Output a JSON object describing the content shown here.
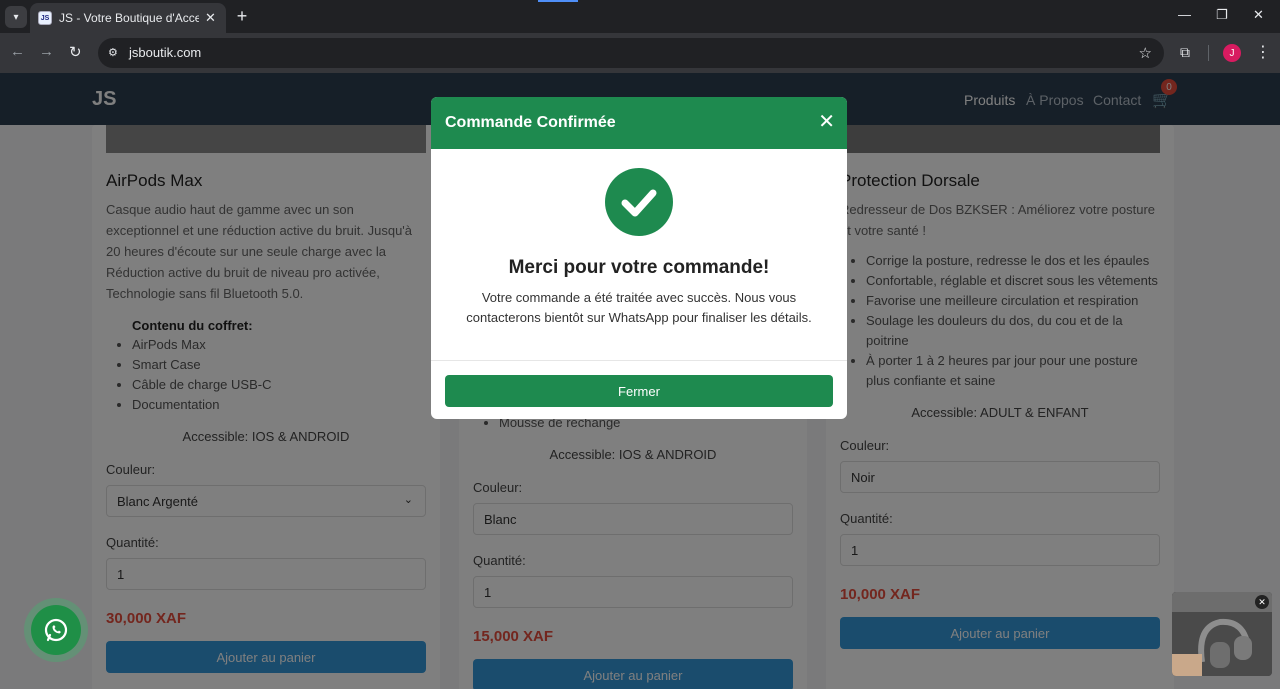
{
  "browser": {
    "tab_title": "JS - Votre Boutique d'Accessoires",
    "favicon_text": "JS",
    "url": "jsboutik.com",
    "profile_initial": "J"
  },
  "site": {
    "logo": "JS",
    "nav": [
      "Produits",
      "À Propos",
      "Contact"
    ],
    "cart_count": "0"
  },
  "products": [
    {
      "name": "AirPods Max",
      "description": "Casque audio haut de gamme avec un son exceptionnel et une réduction active du bruit. Jusqu'à 20 heures d'écoute sur une seule charge avec la Réduction active du bruit de niveau pro activée, Technologie sans fil Bluetooth 5.0.",
      "box_title": "Contenu du coffret:",
      "box_items": [
        "AirPods Max",
        "Smart Case",
        "Câble de charge USB-C",
        "Documentation"
      ],
      "accessible": "Accessible: IOS & ANDROID",
      "color_label": "Couleur:",
      "color_value": "Blanc Argenté",
      "qty_label": "Quantité:",
      "qty_value": "1",
      "price": "30,000 XAF",
      "add_label": "Ajouter au panier"
    },
    {
      "visible_item": "Mousse de rechange",
      "accessible": "Accessible: IOS & ANDROID",
      "color_label": "Couleur:",
      "color_value": "Blanc",
      "qty_label": "Quantité:",
      "qty_value": "1",
      "price": "15,000 XAF",
      "add_label": "Ajouter au panier"
    },
    {
      "name": "Protection Dorsale",
      "description": "Redresseur de Dos BZKSER : Améliorez votre posture et votre santé !",
      "features": [
        "Corrige la posture, redresse le dos et les épaules",
        "Confortable, réglable et discret sous les vêtements",
        "Favorise une meilleure circulation et respiration",
        "Soulage les douleurs du dos, du cou et de la poitrine",
        "À porter 1 à 2 heures par jour pour une posture plus confiante et saine"
      ],
      "accessible": "Accessible: ADULT & ENFANT",
      "color_label": "Couleur:",
      "color_value": "Noir",
      "qty_label": "Quantité:",
      "qty_value": "1",
      "price": "10,000 XAF",
      "add_label": "Ajouter au panier"
    }
  ],
  "modal": {
    "title": "Commande Confirmée",
    "heading": "Merci pour votre commande!",
    "message": "Votre commande a été traitée avec succès. Nous vous contacterons bientôt sur WhatsApp pour finaliser les détails.",
    "button": "Fermer"
  },
  "colors": {
    "success": "#1e8a4f",
    "navbar": "#2c3e50",
    "price": "#e74c3c",
    "primary": "#3498db"
  }
}
